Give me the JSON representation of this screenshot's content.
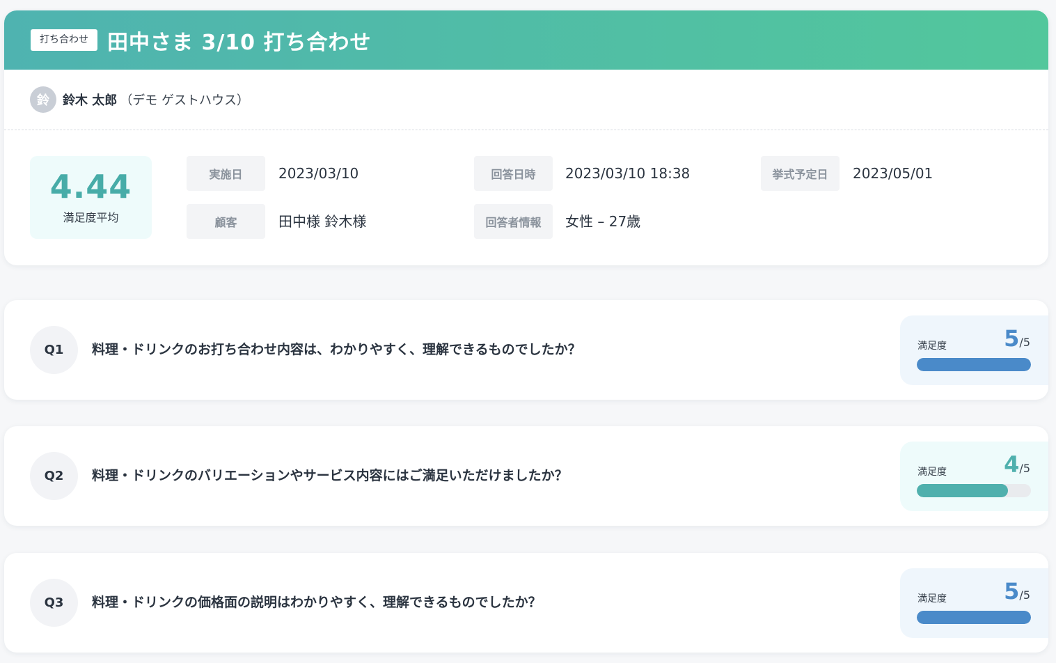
{
  "header": {
    "tag": "打ち合わせ",
    "title": "田中さま 3/10 打ち合わせ"
  },
  "owner": {
    "avatar_initial": "鈴",
    "name": "鈴木 太郎",
    "organization": "（デモ ゲストハウス）"
  },
  "summary": {
    "score": "4.44",
    "score_label": "満足度平均"
  },
  "fields": {
    "date_label": "実施日",
    "date_value": "2023/03/10",
    "answered_label": "回答日時",
    "answered_value": "2023/03/10 18:38",
    "ceremony_label": "挙式予定日",
    "ceremony_value": "2023/05/01",
    "customer_label": "顧客",
    "customer_value": "田中様 鈴木様",
    "respondent_label": "回答者情報",
    "respondent_value": "女性 – 27歳"
  },
  "questions": [
    {
      "number": "Q1",
      "text": "料理・ドリンクのお打ち合わせ内容は、わかりやすく、理解できるものでしたか？",
      "rating_label": "満足度",
      "rating_value": "5",
      "rating_max": "/5",
      "rating_fraction": 1.0,
      "color": "#4a8ac9"
    },
    {
      "number": "Q2",
      "text": "料理・ドリンクのバリエーションやサービス内容にはご満足いただけましたか？",
      "rating_label": "満足度",
      "rating_value": "4",
      "rating_max": "/5",
      "rating_fraction": 0.8,
      "color": "#4fb0ad"
    },
    {
      "number": "Q3",
      "text": "料理・ドリンクの価格面の説明はわかりやすく、理解できるものでしたか？",
      "rating_label": "満足度",
      "rating_value": "5",
      "rating_max": "/5",
      "rating_fraction": 1.0,
      "color": "#4a8ac9"
    }
  ],
  "colors": {
    "banner_start": "#4fb3b0",
    "banner_end": "#52c79c",
    "accent_teal": "#47aca8",
    "accent_blue": "#4a8ac9"
  }
}
